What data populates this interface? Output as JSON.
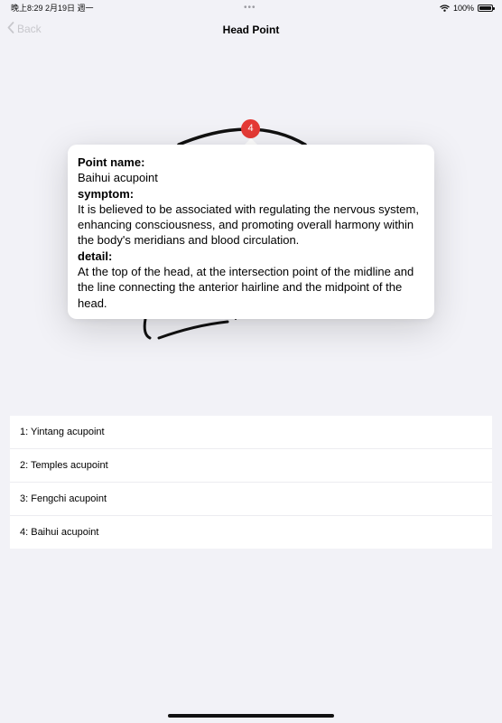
{
  "status_bar": {
    "time": "晚上8:29  2月19日 週一",
    "dots": "•••",
    "battery": "100%"
  },
  "nav": {
    "back_label": "Back",
    "title": "Head Point"
  },
  "marker": {
    "number": "4",
    "color": "#e53935"
  },
  "popover": {
    "name_label": "Point name:",
    "name_value": "Baihui acupoint",
    "symptom_label": "symptom:",
    "symptom_value": "It is believed to be associated with regulating the nervous system, enhancing consciousness, and promoting overall harmony within the body's meridians and blood circulation.",
    "detail_label": "detail:",
    "detail_value": "At the top of the head, at the intersection point of the midline and the line connecting the anterior hairline and the midpoint of the head."
  },
  "points": [
    "1: Yintang acupoint",
    "2: Temples acupoint",
    "3: Fengchi acupoint",
    "4: Baihui acupoint"
  ]
}
